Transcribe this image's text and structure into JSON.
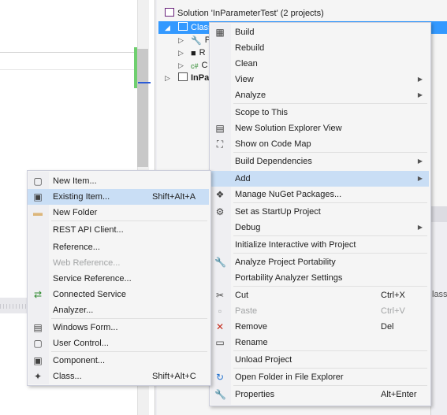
{
  "solution_explorer": {
    "solution_label": "Solution 'InParameterTest' (2 projects)",
    "selected_project": "Class",
    "child_items": [
      "P",
      "R",
      "C"
    ],
    "second_project": "InPa"
  },
  "main_menu": {
    "items": [
      {
        "label": "Build",
        "icon": "build-icon"
      },
      {
        "label": "Rebuild"
      },
      {
        "label": "Clean"
      },
      {
        "label": "View",
        "submenu": true
      },
      {
        "label": "Analyze",
        "submenu": true
      },
      {
        "label": "Scope to This"
      },
      {
        "label": "New Solution Explorer View",
        "icon": "new-view-icon"
      },
      {
        "label": "Show on Code Map",
        "icon": "code-map-icon"
      },
      {
        "label": "Build Dependencies",
        "submenu": true
      },
      {
        "label": "Add",
        "submenu": true,
        "highlighted": true
      },
      {
        "label": "Manage NuGet Packages...",
        "icon": "nuget-icon"
      },
      {
        "label": "Set as StartUp Project",
        "icon": "gear-icon"
      },
      {
        "label": "Debug",
        "submenu": true
      },
      {
        "label": "Initialize Interactive with Project"
      },
      {
        "label": "Analyze Project Portability",
        "icon": "wrench-icon"
      },
      {
        "label": "Portability Analyzer Settings"
      },
      {
        "label": "Cut",
        "shortcut": "Ctrl+X",
        "icon": "scissors-icon"
      },
      {
        "label": "Paste",
        "shortcut": "Ctrl+V",
        "disabled": true,
        "icon": "paste-icon"
      },
      {
        "label": "Remove",
        "shortcut": "Del",
        "icon": "remove-icon"
      },
      {
        "label": "Rename",
        "icon": "rename-icon"
      },
      {
        "label": "Unload Project"
      },
      {
        "label": "Open Folder in File Explorer",
        "icon": "open-folder-icon"
      },
      {
        "label": "Properties",
        "shortcut": "Alt+Enter",
        "icon": "wrench-icon"
      }
    ]
  },
  "add_submenu": {
    "items": [
      {
        "label": "New Item...",
        "icon": "new-item-icon"
      },
      {
        "label": "Existing Item...",
        "shortcut": "Shift+Alt+A",
        "highlighted": true,
        "icon": "existing-item-icon"
      },
      {
        "label": "New Folder",
        "icon": "folder-icon"
      },
      {
        "label": "REST API Client..."
      },
      {
        "label": "Reference..."
      },
      {
        "label": "Web Reference...",
        "disabled": true
      },
      {
        "label": "Service Reference..."
      },
      {
        "label": "Connected Service",
        "icon": "connected-service-icon"
      },
      {
        "label": "Analyzer..."
      },
      {
        "label": "Windows Form...",
        "icon": "windows-form-icon"
      },
      {
        "label": "User Control...",
        "icon": "user-control-icon"
      },
      {
        "label": "Component...",
        "icon": "component-icon"
      },
      {
        "label": "Class...",
        "shortcut": "Shift+Alt+C",
        "icon": "class-icon"
      }
    ]
  },
  "lower_panel_text": "lass",
  "colors": {
    "highlight": "#c9def5",
    "selection": "#3399ff",
    "menu_bg": "#f5f5f5",
    "disabled": "#a2a4a5"
  }
}
